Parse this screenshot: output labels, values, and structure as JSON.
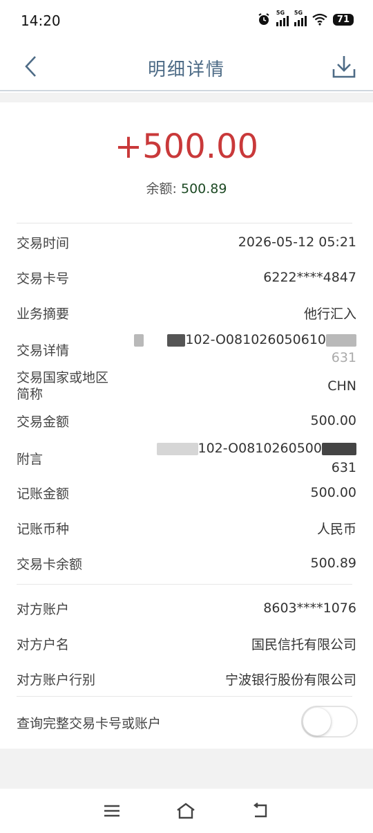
{
  "status": {
    "time": "14:20",
    "battery": "71"
  },
  "nav": {
    "title": "明细详情",
    "back_icon": "chevron-left-icon",
    "download_icon": "download-icon"
  },
  "summary": {
    "amount": "+500.00",
    "balance_label": "余额:",
    "balance_value": "500.89"
  },
  "details": [
    {
      "label": "交易时间",
      "value": "2026-05-12 05:21"
    },
    {
      "label": "交易卡号",
      "value": "6222****4847"
    },
    {
      "label": "业务摘要",
      "value": "他行汇入"
    },
    {
      "label": "交易详情",
      "value": "102-O081026050610",
      "value2": "631"
    },
    {
      "label": "交易国家或地区",
      "label2": "简称",
      "value": "CHN"
    },
    {
      "label": "交易金额",
      "value": "500.00"
    },
    {
      "label": "附言",
      "value": "102-O0810260500",
      "value2": "631"
    },
    {
      "label": "记账金额",
      "value": "500.00"
    },
    {
      "label": "记账币种",
      "value": "人民币"
    },
    {
      "label": "交易卡余额",
      "value": "500.89"
    }
  ],
  "counterparty": [
    {
      "label": "对方账户",
      "value": "8603****1076"
    },
    {
      "label": "对方户名",
      "value": "国民信托有限公司"
    },
    {
      "label": "对方账户行别",
      "value": "宁波银行股份有限公司"
    }
  ],
  "toggle": {
    "label": "查询完整交易卡号或账户",
    "state": "off"
  },
  "colors": {
    "amount": "#c9393a",
    "balance": "#1d4a24",
    "title": "#4d6b86"
  }
}
